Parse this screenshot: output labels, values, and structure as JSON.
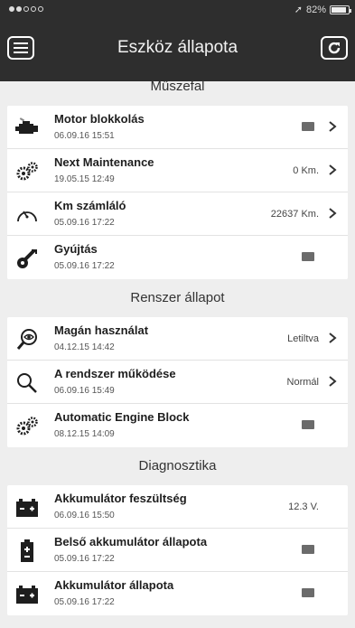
{
  "status_bar": {
    "battery": "82%",
    "battery_level": 0.82
  },
  "header": {
    "title": "Eszköz állapota"
  },
  "sections": [
    {
      "title": "Műszefal",
      "rows": [
        {
          "icon": "engine-icon",
          "title": "Motor blokkolás",
          "time": "06.09.16 15:51",
          "value": "",
          "has_chevron": true
        },
        {
          "icon": "gears-icon",
          "title": "Next Maintenance",
          "time": "19.05.15 12:49",
          "value": "0 Km.",
          "has_chevron": true
        },
        {
          "icon": "speedometer-icon",
          "title": "Km számláló",
          "time": "05.09.16 17:22",
          "value": "22637 Km.",
          "has_chevron": true
        },
        {
          "icon": "ignition-key-icon",
          "title": "Gyújtás",
          "time": "05.09.16 17:22",
          "value": "",
          "has_chevron": false
        }
      ]
    },
    {
      "title": "Renszer állapot",
      "rows": [
        {
          "icon": "eye-magnifier-icon",
          "title": "Magán használat",
          "time": "04.12.15 14:42",
          "value": "Letiltva",
          "has_chevron": true
        },
        {
          "icon": "search-icon",
          "title": "A rendszer működése",
          "time": "06.09.16 15:49",
          "value": "Normál",
          "has_chevron": true
        },
        {
          "icon": "gears-icon",
          "title": "Automatic Engine Block",
          "time": "08.12.15 14:09",
          "value": "",
          "has_chevron": false
        }
      ]
    },
    {
      "title": "Diagnosztika",
      "rows": [
        {
          "icon": "car-battery-icon",
          "title": "Akkumulátor feszültség",
          "time": "06.09.16 15:50",
          "value": "12.3 V.",
          "has_chevron": false
        },
        {
          "icon": "internal-battery-icon",
          "title": "Belső akkumulátor állapota",
          "time": "05.09.16 17:22",
          "value": "",
          "has_chevron": false
        },
        {
          "icon": "car-battery-icon",
          "title": "Akkumulátor állapota",
          "time": "05.09.16 17:22",
          "value": "",
          "has_chevron": false
        }
      ]
    }
  ]
}
